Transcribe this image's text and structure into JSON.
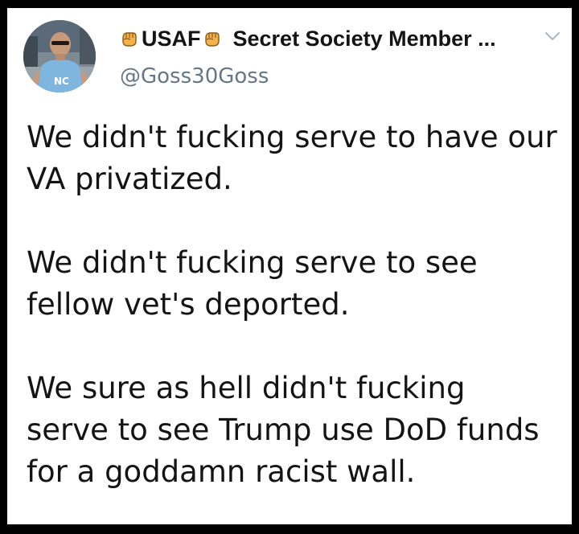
{
  "tweet": {
    "author": {
      "name_prefix": "USAF",
      "name_rest": "Secret Society Member ...",
      "handle": "@Goss30Goss",
      "avatar_icon": "profile-photo",
      "badge_icon": "raised-fist-emoji"
    },
    "menu_icon": "chevron-down-icon",
    "paragraphs": [
      {
        "lines": [
          "We didn't fucking serve to have our",
          "VA privatized."
        ]
      },
      {
        "lines": [
          "We didn't fucking serve to see",
          "fellow vet's deported."
        ]
      },
      {
        "lines": [
          "We sure as hell didn't fucking",
          "serve to see Trump use DoD funds",
          "for a goddamn racist wall."
        ]
      }
    ]
  },
  "colors": {
    "background": "#000000",
    "card": "#ffffff",
    "text": "#141414",
    "handle": "#657786"
  }
}
